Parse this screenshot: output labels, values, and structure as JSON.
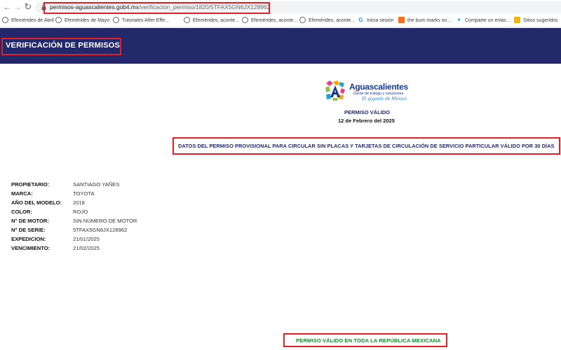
{
  "browser": {
    "url_host": "permisos-aguascalientes.gob4.mx",
    "url_path": "/verificacion_permiso/1820/5TFAX5GN6JX128962",
    "bookmarks": [
      {
        "label": "Efemérides de Abril",
        "icon": "globe-icon"
      },
      {
        "label": "Efemérides de Mayo",
        "icon": "globe-icon"
      },
      {
        "label": "Tutoriales After Effe...",
        "icon": "globe-icon"
      },
      {
        "label": "Efemérides, aconte...",
        "icon": "globe-icon"
      },
      {
        "label": "Efemérides, aconte...",
        "icon": "globe-icon"
      },
      {
        "label": "Efemérides, aconte...",
        "icon": "globe-icon"
      },
      {
        "label": "Inicia sesión",
        "icon": "google-icon"
      },
      {
        "label": "the burn marks on...",
        "icon": "soundcloud-icon"
      },
      {
        "label": "Comparte un enlac...",
        "icon": "twitter-icon"
      },
      {
        "label": "Sitios sugeridos",
        "icon": "folder-icon"
      }
    ]
  },
  "header": {
    "title": "VERIFICACIÓN DE PERMISOS",
    "background_color": "#23286a"
  },
  "logo": {
    "name": "Aguascalientes",
    "tagline": "Gente de trabajo y soluciones",
    "slogan": "El gigante de México"
  },
  "status": {
    "title": "PERMISO VÁLIDO",
    "date": "12 de Febrero del 2025"
  },
  "section_title": "DATOS DEL PERMISO PROVISIONAL PARA CIRCULAR SIN PLACAS Y TARJETAS DE CIRCULACIÓN DE SERVICIO PARTICULAR VÁLIDO POR 30 DÍAS",
  "fields": [
    {
      "label": "PROPIETARIO:",
      "value": "SANTIAGO YAÑES"
    },
    {
      "label": "MARCA:",
      "value": "TOYOTA"
    },
    {
      "label": "AÑO DEL MODELO:",
      "value": "2018"
    },
    {
      "label": "COLOR:",
      "value": "ROJO"
    },
    {
      "label": "N° DE MOTOR:",
      "value": "SIN NÚMERO DE MOTOR"
    },
    {
      "label": "N° DE SERIE:",
      "value": "5TFAX5GN6JX128962"
    },
    {
      "label": "EXPEDICION:",
      "value": "21/01/2025"
    },
    {
      "label": "VENCIMIENTO:",
      "value": "21/02/2025"
    }
  ],
  "footer": {
    "text": "PERMISO VÁLIDO EN TODA LA REPÚBLICA MEXICANA",
    "color": "#1a8a2e"
  },
  "highlight_color": "#e31e24"
}
